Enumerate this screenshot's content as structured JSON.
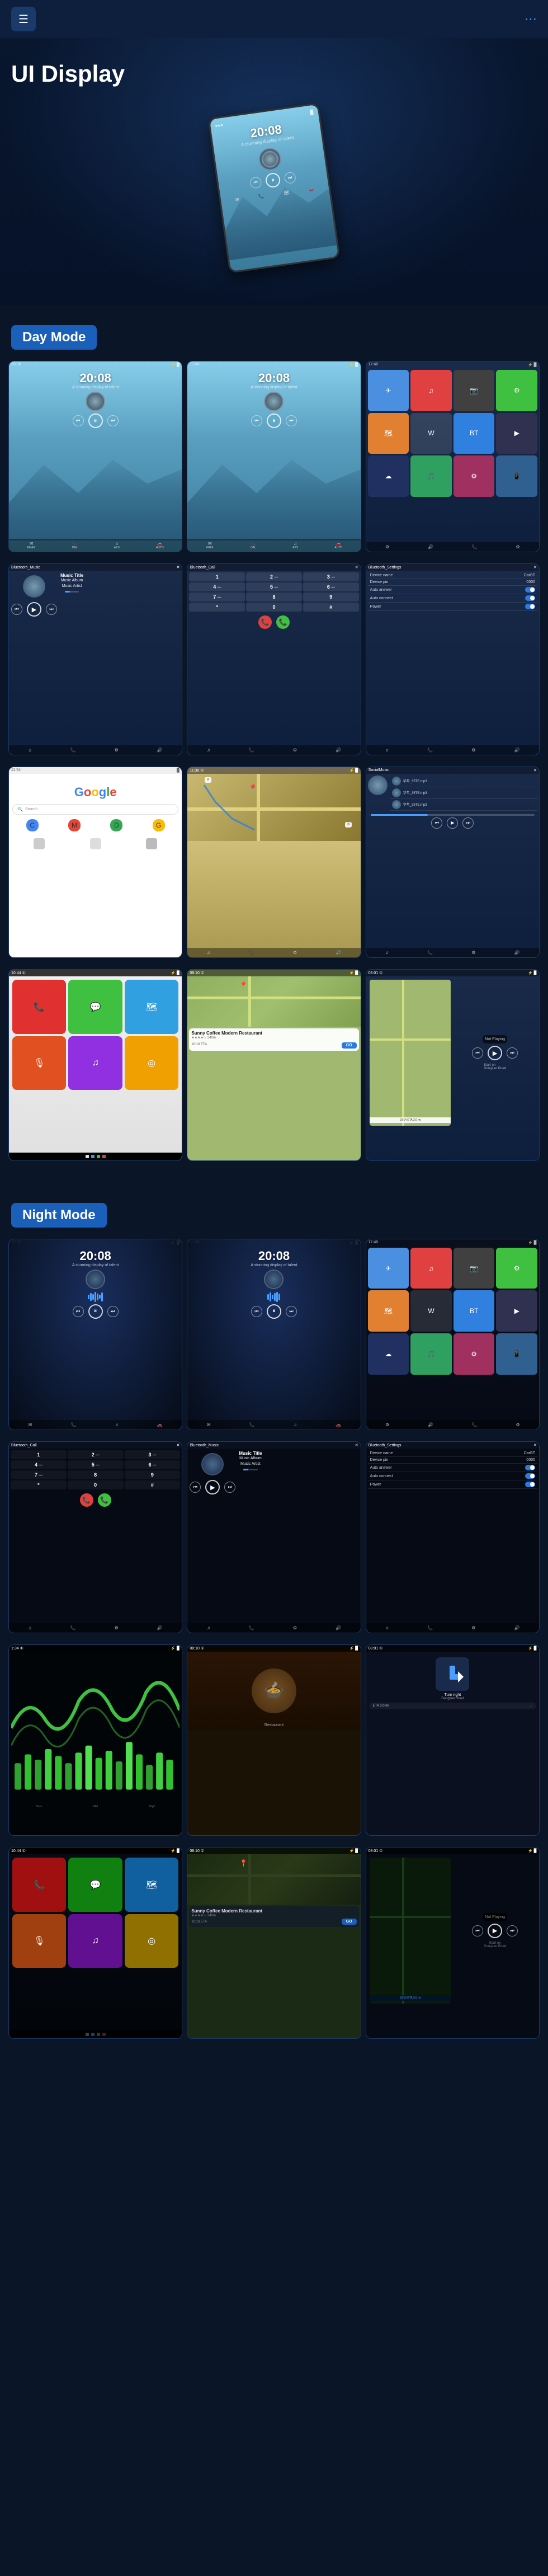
{
  "header": {
    "logo_text": "≡",
    "menu_icon": "≡",
    "nav_icon": "⋯"
  },
  "hero": {
    "title": "UI Display",
    "device_time": "20:08",
    "device_date": "A stunning display of talent"
  },
  "day_mode": {
    "label": "Day Mode",
    "screens": [
      {
        "type": "music_day",
        "time": "20:08",
        "subtitle": "A stunning display of talent"
      },
      {
        "type": "music_day2",
        "time": "20:08",
        "subtitle": "A stunning display of talent"
      },
      {
        "type": "apps_day"
      },
      {
        "type": "bluetooth_music",
        "title": "Bluetooth_Music"
      },
      {
        "type": "bluetooth_call",
        "title": "Bluetooth_Call"
      },
      {
        "type": "bluetooth_settings",
        "title": "Bluetooth_Settings"
      },
      {
        "type": "google"
      },
      {
        "type": "navigation"
      },
      {
        "type": "social_music",
        "title": "SocialMusic"
      }
    ]
  },
  "day_mode_row2": {
    "screens": [
      {
        "type": "carplay_apps"
      },
      {
        "type": "navigation_coffee"
      },
      {
        "type": "music_not_playing"
      }
    ]
  },
  "night_mode": {
    "label": "Night Mode",
    "screens": [
      {
        "type": "music_night",
        "time": "20:08"
      },
      {
        "type": "music_night2",
        "time": "20:08"
      },
      {
        "type": "apps_night"
      },
      {
        "type": "bluetooth_call_night",
        "title": "Bluetooth_Call"
      },
      {
        "type": "bluetooth_music_night",
        "title": "Bluetooth_Music"
      },
      {
        "type": "bluetooth_settings_night",
        "title": "Bluetooth_Settings"
      },
      {
        "type": "waveform_night"
      },
      {
        "type": "food_night"
      },
      {
        "type": "navigation_night"
      }
    ]
  },
  "night_mode_row2": {
    "screens": [
      {
        "type": "carplay_apps_night"
      },
      {
        "type": "navigation_coffee_night"
      },
      {
        "type": "music_not_playing_night"
      }
    ]
  },
  "music": {
    "title": "Music Title",
    "album": "Music Album",
    "artist": "Music Artist"
  },
  "settings": {
    "device_name_label": "Device name",
    "device_name_value": "CarBT",
    "device_pin_label": "Device pin",
    "device_pin_value": "0000",
    "auto_answer_label": "Auto answer",
    "auto_connect_label": "Auto connect",
    "power_label": "Power"
  },
  "navigation": {
    "coffee_shop": "Sunny Coffee Modern Restaurant",
    "eta_label": "16:18 ETA",
    "distance": "3.0 mi",
    "go_label": "GO",
    "start_label": "Start on Dongzao Road"
  },
  "icons": {
    "menu": "☰",
    "dots": "⋯",
    "play": "▶",
    "pause": "⏸",
    "prev": "⏮",
    "next": "⏭",
    "skip_back": "⏪",
    "skip_fwd": "⏩",
    "phone": "📞",
    "home": "⌂",
    "settings": "⚙",
    "music_note": "♫",
    "search": "🔍",
    "navigation_arrow": "➤",
    "star": "★",
    "map_pin": "📍"
  },
  "app_colors": {
    "red": "#e03030",
    "green": "#30c030",
    "blue": "#3080e0",
    "orange": "#e08030",
    "purple": "#9030e0",
    "teal": "#30b0b0",
    "yellow": "#e0c030",
    "pink": "#e03080",
    "light_blue": "#30a0e0",
    "gray": "#606070",
    "dark_blue": "#2060b0",
    "gold": "#c0a030"
  }
}
